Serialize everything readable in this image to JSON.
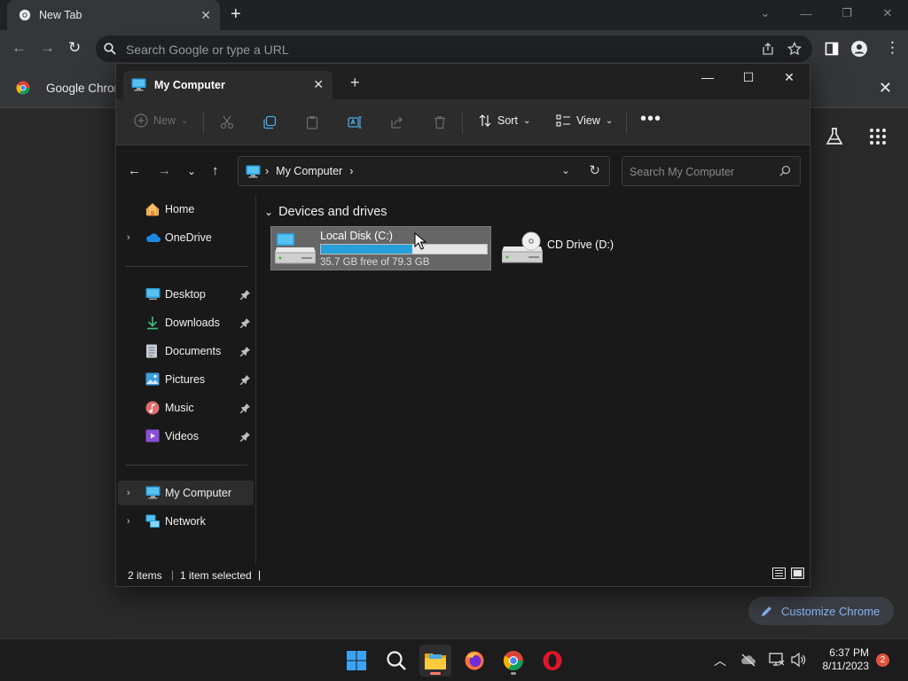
{
  "chrome": {
    "tab_title": "New Tab",
    "omnibox_placeholder": "Search Google or type a URL",
    "bookmark_label": "Google Chrome",
    "customize_label": "Customize Chrome"
  },
  "explorer": {
    "tab_title": "My Computer",
    "commands": {
      "new": "New",
      "sort": "Sort",
      "view": "View"
    },
    "address": {
      "crumb": "My Computer"
    },
    "search_placeholder": "Search My Computer",
    "nav": {
      "home": "Home",
      "onedrive": "OneDrive",
      "desktop": "Desktop",
      "downloads": "Downloads",
      "documents": "Documents",
      "pictures": "Pictures",
      "music": "Music",
      "videos": "Videos",
      "my_computer": "My Computer",
      "network": "Network"
    },
    "group_header": "Devices and drives",
    "drives": [
      {
        "name": "Local Disk (C:)",
        "free_text": "35.7 GB free of 79.3 GB",
        "used_fraction": 0.55,
        "selected": true
      },
      {
        "name": "CD Drive (D:)",
        "selected": false
      }
    ],
    "status": {
      "items": "2 items",
      "selected": "1 item selected",
      "divider": "|",
      "trailing": "|"
    }
  },
  "taskbar": {
    "time": "6:37 PM",
    "date": "8/11/2023",
    "notifications": "2"
  },
  "colors": {
    "accent_blue": "#26a0da",
    "chrome_link": "#8ab4f8",
    "badge": "#e0533c"
  }
}
